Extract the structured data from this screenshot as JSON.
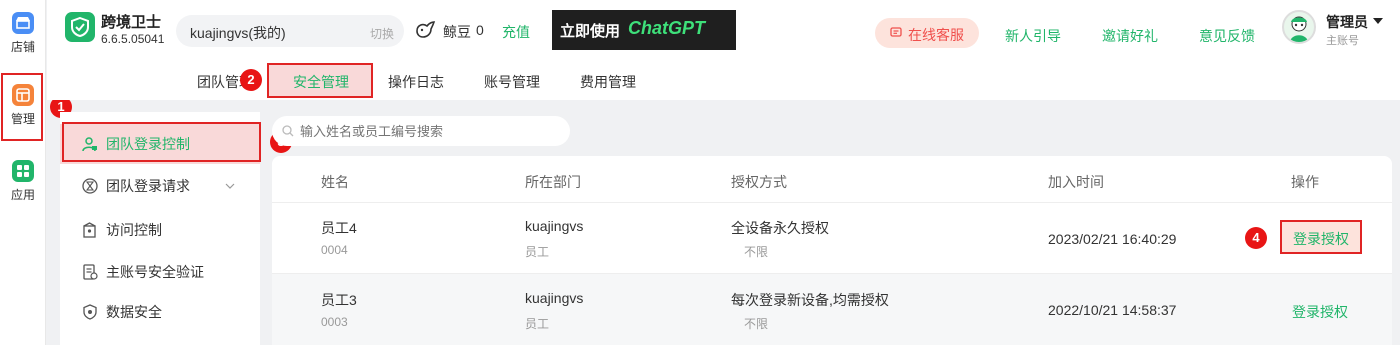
{
  "rail": {
    "items": [
      {
        "label": "店铺",
        "icon": "store-icon"
      },
      {
        "label": "管理",
        "icon": "manage-icon"
      },
      {
        "label": "应用",
        "icon": "apps-icon"
      }
    ]
  },
  "header": {
    "app_name": "跨境卫士",
    "version": "6.6.5.05041",
    "account": "kuajingvs(我的)",
    "switch_label": "切换",
    "beans_label": "鲸豆",
    "beans_count": "0",
    "recharge": "充值",
    "banner_text_cn": "立即使用",
    "banner_text_en": "ChatGPT",
    "online_service": "在线客服",
    "links": [
      "新人引导",
      "邀请好礼",
      "意见反馈"
    ],
    "user_name": "管理员",
    "user_role": "主账号"
  },
  "tabs": [
    "团队管理",
    "安全管理",
    "操作日志",
    "账号管理",
    "费用管理"
  ],
  "sidebar": {
    "items": [
      {
        "label": "团队登录控制",
        "icon": "user-lock-icon"
      },
      {
        "label": "团队登录请求",
        "icon": "request-icon"
      },
      {
        "label": "访问控制",
        "icon": "access-control-icon"
      },
      {
        "label": "主账号安全验证",
        "icon": "verify-icon"
      },
      {
        "label": "数据安全",
        "icon": "shield-icon"
      }
    ]
  },
  "search": {
    "placeholder": "输入姓名或员工编号搜索"
  },
  "table": {
    "headers": [
      "姓名",
      "所在部门",
      "授权方式",
      "加入时间",
      "操作"
    ],
    "rows": [
      {
        "name": "员工4",
        "id": "0004",
        "dept": "kuajingvs",
        "dept_sub": "员工",
        "auth": "全设备永久授权",
        "auth_sub": "不限",
        "time": "2023/02/21 16:40:29",
        "action": "登录授权"
      },
      {
        "name": "员工3",
        "id": "0003",
        "dept": "kuajingvs",
        "dept_sub": "员工",
        "auth": "每次登录新设备,均需授权",
        "auth_sub": "不限",
        "time": "2022/10/21 14:58:37",
        "action": "登录授权"
      }
    ]
  },
  "annotations": [
    "1",
    "2",
    "3",
    "4"
  ],
  "colors": {
    "accent": "#21b56a",
    "annotation": "#e81515",
    "service": "#f0504d"
  }
}
